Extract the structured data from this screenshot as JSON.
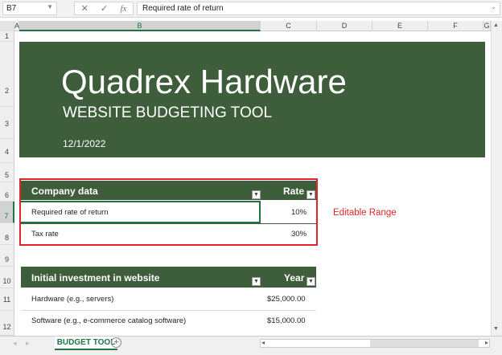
{
  "formula_bar": {
    "name_box": "B7",
    "cancel_icon": "✕",
    "enter_icon": "✓",
    "fx_label": "fx",
    "formula": "Required rate of return"
  },
  "columns": [
    "A",
    "B",
    "C",
    "D",
    "E",
    "F",
    "G"
  ],
  "rows": [
    "1",
    "2",
    "3",
    "4",
    "5",
    "6",
    "7",
    "8",
    "9",
    "10",
    "11",
    "12"
  ],
  "banner": {
    "title": "Quadrex Hardware",
    "subtitle": "WEBSITE BUDGETING TOOL",
    "date": "12/1/2022"
  },
  "company_table": {
    "header": "Company data",
    "rate_header": "Rate",
    "rows": [
      {
        "label": "Required rate of return",
        "value": "10%"
      },
      {
        "label": "Tax rate",
        "value": "30%"
      }
    ]
  },
  "editable_note": "Editable Range",
  "investment_table": {
    "header": "Initial investment in website",
    "year_header": "Year",
    "rows": [
      {
        "label": "Hardware (e.g., servers)",
        "value": "$25,000.00"
      },
      {
        "label": "Software (e.g., e-commerce catalog software)",
        "value": "$15,000.00"
      }
    ]
  },
  "sheet_tab": "BUDGET TOOL",
  "colors": {
    "accent": "#3e5e3b",
    "highlight": "#e0262b",
    "excel_green": "#217346"
  }
}
